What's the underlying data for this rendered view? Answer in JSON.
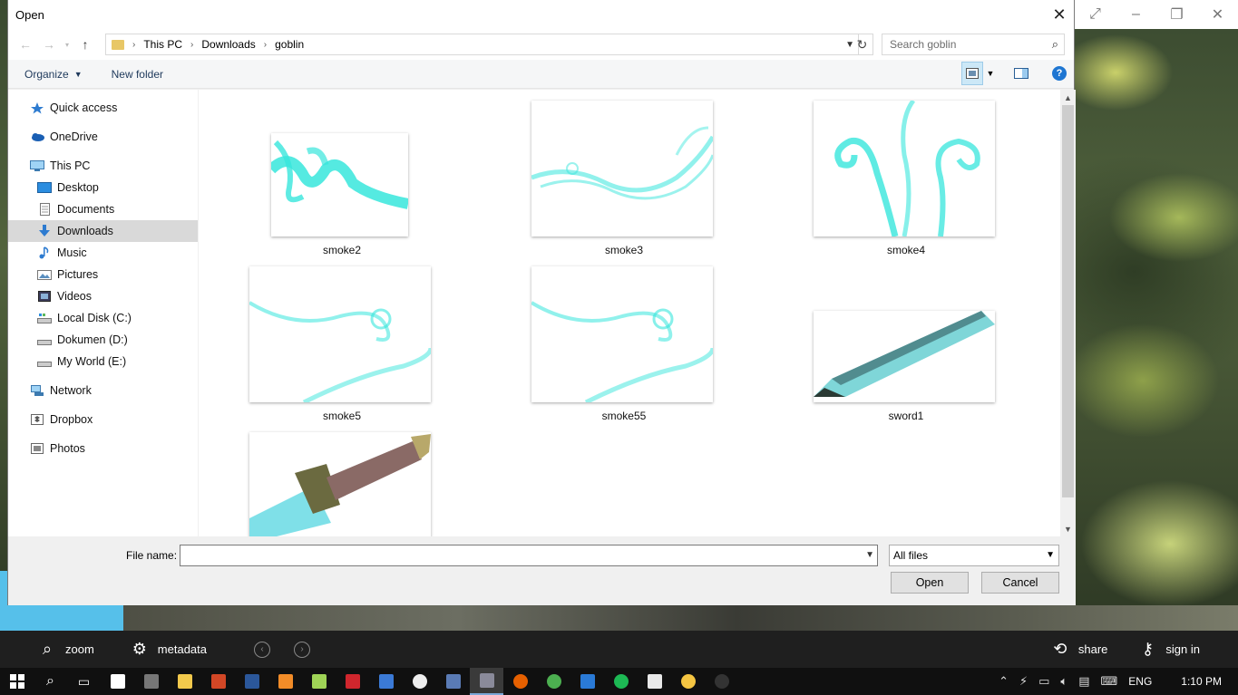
{
  "dialog": {
    "title": "Open"
  },
  "address": {
    "crumbs": [
      "This PC",
      "Downloads",
      "goblin"
    ]
  },
  "search": {
    "placeholder": "Search goblin"
  },
  "toolbar": {
    "organize": "Organize",
    "new_folder": "New folder",
    "help": "?"
  },
  "sidebar": {
    "items": [
      {
        "label": "Quick access",
        "icon": "star-icon"
      },
      {
        "label": "OneDrive",
        "icon": "cloud-icon"
      },
      {
        "label": "This PC",
        "icon": "computer-icon"
      },
      {
        "label": "Desktop",
        "icon": "desktop-icon"
      },
      {
        "label": "Documents",
        "icon": "documents-icon"
      },
      {
        "label": "Downloads",
        "icon": "download-icon",
        "selected": true
      },
      {
        "label": "Music",
        "icon": "music-icon"
      },
      {
        "label": "Pictures",
        "icon": "pictures-icon"
      },
      {
        "label": "Videos",
        "icon": "videos-icon"
      },
      {
        "label": "Local Disk (C:)",
        "icon": "drive-icon"
      },
      {
        "label": "Dokumen (D:)",
        "icon": "drive-icon"
      },
      {
        "label": "My World (E:)",
        "icon": "drive-icon"
      },
      {
        "label": "Network",
        "icon": "network-icon"
      },
      {
        "label": "Dropbox",
        "icon": "dropbox-icon"
      },
      {
        "label": "Photos",
        "icon": "photos-icon"
      }
    ]
  },
  "files": [
    {
      "name": "smoke2"
    },
    {
      "name": "smoke3"
    },
    {
      "name": "smoke4"
    },
    {
      "name": "smoke5"
    },
    {
      "name": "smoke55"
    },
    {
      "name": "sword1"
    },
    {
      "name": ""
    }
  ],
  "footer": {
    "file_name_label": "File name:",
    "file_name_value": "",
    "filter": "All files",
    "open": "Open",
    "cancel": "Cancel"
  },
  "appbar": {
    "zoom": "zoom",
    "metadata": "metadata",
    "share": "share",
    "sign_in": "sign in"
  },
  "taskbar": {
    "language": "ENG",
    "time": "1:10 PM"
  },
  "colors": {
    "accent": "#1e76d2",
    "smoke": "#37e6dc",
    "selected_nav": "#d9d9d9"
  }
}
